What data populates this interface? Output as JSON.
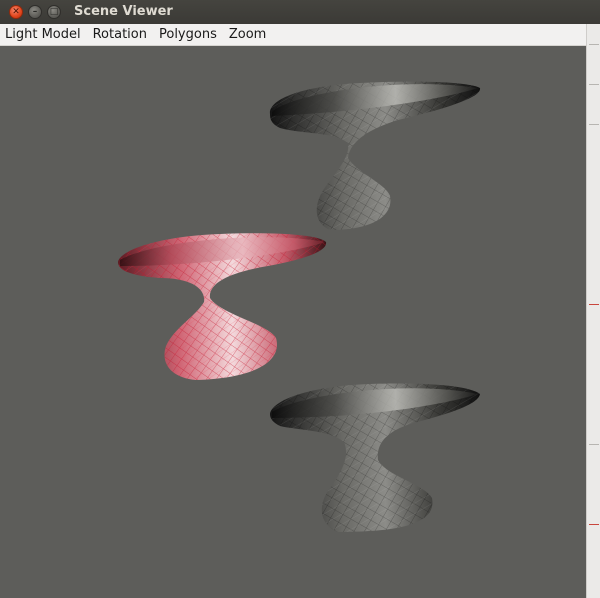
{
  "window": {
    "title": "Scene Viewer",
    "controls": {
      "close_icon": "close-icon",
      "minimize_icon": "minimize-icon",
      "maximize_icon": "maximize-icon"
    }
  },
  "menubar": {
    "items": [
      {
        "label": "Light Model"
      },
      {
        "label": "Rotation"
      },
      {
        "label": "Polygons"
      },
      {
        "label": "Zoom"
      }
    ]
  },
  "scene": {
    "background_color": "#5d5d5a",
    "models": [
      {
        "name": "vase-model-top",
        "material": "gray-wireframe",
        "selected": false,
        "color": "#3a3a38"
      },
      {
        "name": "vase-model-middle",
        "material": "red-wireframe",
        "selected": true,
        "color": "#d2566a"
      },
      {
        "name": "vase-model-bottom",
        "material": "gray-wireframe",
        "selected": false,
        "color": "#3a3a38"
      }
    ]
  }
}
